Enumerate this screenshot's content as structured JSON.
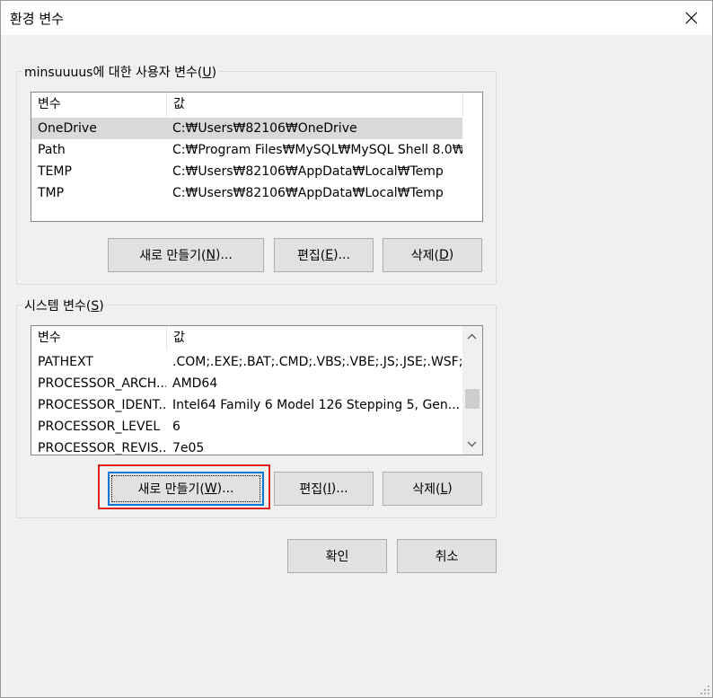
{
  "window": {
    "title": "환경 변수",
    "close_icon": "close-icon"
  },
  "user_vars": {
    "group_label": "minsuuuus에 대한 사용자 변수(U)",
    "group_label_pre": "minsuuuus에 대한 사용자 변수(",
    "group_label_mnemonic": "U",
    "group_label_post": ")",
    "columns": [
      "변수",
      "값"
    ],
    "rows": [
      {
        "name": "OneDrive",
        "value": "C:₩Users₩82106₩OneDrive",
        "selected": true
      },
      {
        "name": "Path",
        "value": "C:₩Program Files₩MySQL₩MySQL Shell 8.0₩...",
        "selected": false
      },
      {
        "name": "TEMP",
        "value": "C:₩Users₩82106₩AppData₩Local₩Temp",
        "selected": false
      },
      {
        "name": "TMP",
        "value": "C:₩Users₩82106₩AppData₩Local₩Temp",
        "selected": false
      }
    ],
    "buttons": {
      "new": {
        "pre": "새로 만들기(",
        "key": "N",
        "post": ")..."
      },
      "edit": {
        "pre": "편집(",
        "key": "E",
        "post": ")..."
      },
      "delete": {
        "pre": "삭제(",
        "key": "D",
        "post": ")"
      }
    }
  },
  "system_vars": {
    "group_label_pre": "시스템 변수(",
    "group_label_mnemonic": "S",
    "group_label_post": ")",
    "columns": [
      "변수",
      "값"
    ],
    "rows": [
      {
        "name": "PATHEXT",
        "value": ".COM;.EXE;.BAT;.CMD;.VBS;.VBE;.JS;.JSE;.WSF;...."
      },
      {
        "name": "PROCESSOR_ARCH...",
        "value": "AMD64"
      },
      {
        "name": "PROCESSOR_IDENT...",
        "value": "Intel64 Family 6 Model 126 Stepping 5, Gen..."
      },
      {
        "name": "PROCESSOR_LEVEL",
        "value": "6"
      },
      {
        "name": "PROCESSOR_REVIS...",
        "value": "7e05"
      }
    ],
    "scroll_position": 0.62,
    "buttons": {
      "new": {
        "pre": "새로 만들기(",
        "key": "W",
        "post": ")..."
      },
      "edit": {
        "pre": "편집(",
        "key": "I",
        "post": ")..."
      },
      "delete": {
        "pre": "삭제(",
        "key": "L",
        "post": ")"
      }
    }
  },
  "footer": {
    "ok_label": "확인",
    "cancel_label": "취소"
  },
  "colors": {
    "highlight": "#e02020",
    "focus": "#0078d7",
    "selected_row": "#d9d9d9"
  }
}
